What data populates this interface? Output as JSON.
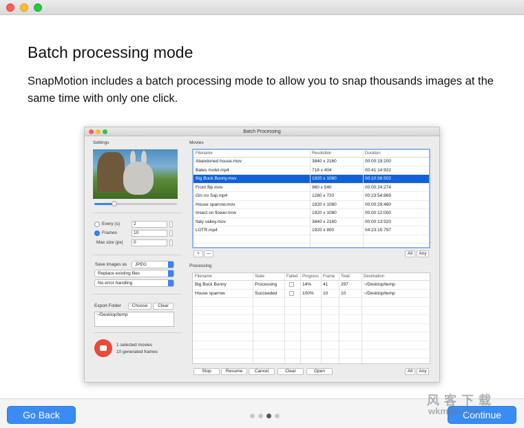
{
  "heading": "Batch processing mode",
  "description": "SnapMotion includes a batch processing mode to allow you to snap thousands images at the same time with only one click.",
  "shot": {
    "title": "Batch Processing",
    "settings_label": "Settings",
    "every_label": "Every (s)",
    "every_value": "2",
    "frames_label": "Frames",
    "frames_value": "10",
    "maxsize_label": "Max size (px)",
    "maxsize_value": "0",
    "save_as_label": "Save images as",
    "format": "JPEG",
    "replace": "Replace existing files",
    "error_handling": "No error handling",
    "export_label": "Export Folder",
    "choose": "Choose",
    "clear": "Clear",
    "export_path": "~/Desktop/temp",
    "selected_movies": "1 selected movies",
    "generated_frames": "10 generated frames",
    "movies_label": "Movies",
    "movies_headers": [
      "Filename",
      "Resolution",
      "Duration"
    ],
    "movies": [
      [
        "Abandoned house.mov",
        "3840 x 2160",
        "00:00:19:200"
      ],
      [
        "Bates motel.mp4",
        "718 x 404",
        "00:41:14:922"
      ],
      [
        "Big Buck Bunny.mov",
        "1920 x 1080",
        "00:10:56:502"
      ],
      [
        "Front flip.mov",
        "960 x 540",
        "00:00:24:274"
      ],
      [
        "Gin no Saji.mp4",
        "1280 x 720",
        "00:23:54:869"
      ],
      [
        "House sparrow.mov",
        "1920 x 1080",
        "00:00:29:480"
      ],
      [
        "Insect on flower.mov",
        "1920 x 1080",
        "00:00:12:000"
      ],
      [
        "Italy valley.mov",
        "3840 x 2160",
        "00:00:13:920"
      ],
      [
        "LOTR.mp4",
        "1920 x 800",
        "04:23:15:797"
      ]
    ],
    "plus": "+",
    "minus": "—",
    "all": "All",
    "any": "Any",
    "processing_label": "Processing",
    "proc_headers": [
      "Filename",
      "State",
      "Failed",
      "Progress",
      "Frame",
      "Total",
      "Destination"
    ],
    "proc_rows": [
      [
        "Big Buck Bunny",
        "Processing",
        "",
        "14%",
        "41",
        "297",
        "~/Desktop/temp"
      ],
      [
        "House sparrow",
        "Succeeded",
        "",
        "100%",
        "10",
        "10",
        "~/Desktop/temp"
      ]
    ],
    "stop": "Stop",
    "resume": "Resume",
    "cancel": "Cancel",
    "clear2": "Clear",
    "open": "Open"
  },
  "go_back": "Go Back",
  "continue": "Continue",
  "watermark_top": "风 客 下 载",
  "watermark_bottom": "wkmdd.com"
}
